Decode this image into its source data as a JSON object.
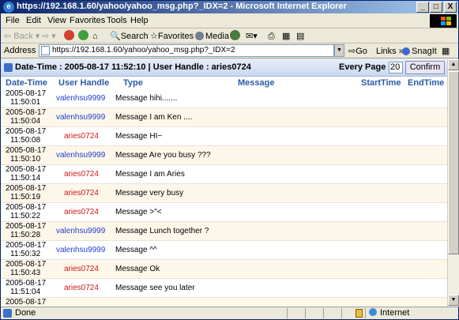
{
  "window": {
    "title": "https://192.168.1.60/yahoo/yahoo_msg.php?_IDX=2 - Microsoft Internet Explorer",
    "minimize": "_",
    "maximize": "□",
    "close": "X"
  },
  "menu": [
    "File",
    "Edit",
    "View",
    "Favorites",
    "Tools",
    "Help"
  ],
  "toolbar": {
    "back": "Back",
    "search": "Search",
    "favorites": "Favorites",
    "media": "Media"
  },
  "address": {
    "label": "Address",
    "url": "https://192.168.1.60/yahoo/yahoo_msg.php?_IDX=2",
    "go": "Go",
    "links": "Links",
    "snagit": "SnagIt"
  },
  "infobar": {
    "text": "Date-Time : 2005-08-17 11:52:10 | User Handle : aries0724",
    "every_page_label": "Every Page :",
    "every_page_value": "20",
    "confirm": "Confirm"
  },
  "columns": {
    "datetime": "Date-Time",
    "user": "User Handle",
    "type": "Type",
    "message": "Message",
    "start": "StartTime",
    "end": "EndTime"
  },
  "rows": [
    {
      "date": "2005-08-17",
      "time": "11:50:01",
      "user": "valenhsu9999",
      "text": "Message hihi......."
    },
    {
      "date": "2005-08-17",
      "time": "11:50:04",
      "user": "valenhsu9999",
      "text": "Message I am Ken ...."
    },
    {
      "date": "2005-08-17",
      "time": "11:50:08",
      "user": "aries0724",
      "text": "Message HI~"
    },
    {
      "date": "2005-08-17",
      "time": "11:50:10",
      "user": "valenhsu9999",
      "text": "Message Are you busy ???"
    },
    {
      "date": "2005-08-17",
      "time": "11:50:14",
      "user": "aries0724",
      "text": "Message I am Aries"
    },
    {
      "date": "2005-08-17",
      "time": "11:50:19",
      "user": "aries0724",
      "text": "Message very busy"
    },
    {
      "date": "2005-08-17",
      "time": "11:50:22",
      "user": "aries0724",
      "text": "Message >\"<"
    },
    {
      "date": "2005-08-17",
      "time": "11:50:28",
      "user": "valenhsu9999",
      "text": "Message Lunch together ?"
    },
    {
      "date": "2005-08-17",
      "time": "11:50:32",
      "user": "valenhsu9999",
      "text": "Message ^^"
    },
    {
      "date": "2005-08-17",
      "time": "11:50:43",
      "user": "aries0724",
      "text": "Message Ok"
    },
    {
      "date": "2005-08-17",
      "time": "11:51:04",
      "user": "aries0724",
      "text": "Message see you later"
    },
    {
      "date": "2005-08-17",
      "time": "",
      "user": "",
      "text": ""
    }
  ],
  "status": {
    "done": "Done",
    "zone": "Internet"
  },
  "colors": {
    "user_blue": "#1f3fd0",
    "user_red": "#d01818",
    "header_blue": "#2b5ca8"
  }
}
